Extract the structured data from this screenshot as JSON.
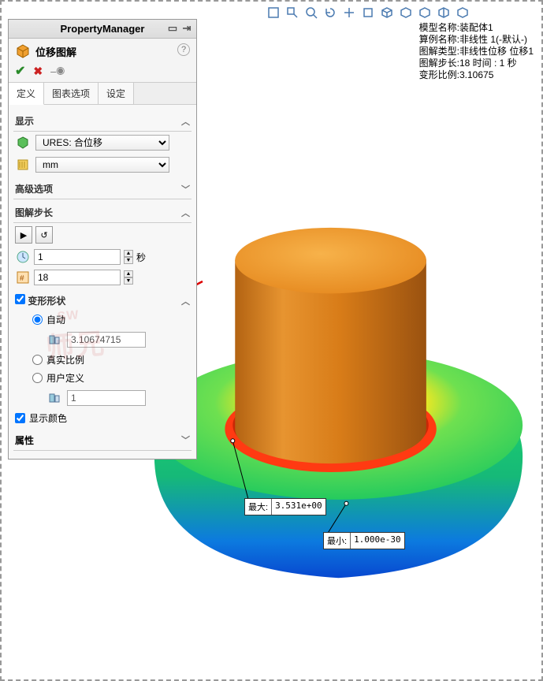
{
  "header": {
    "title": "PropertyManager"
  },
  "title_row": {
    "label": "位移图解"
  },
  "tabs": {
    "t0": "定义",
    "t1": "图表选项",
    "t2": "设定"
  },
  "sections": {
    "display": {
      "title": "显示",
      "component_select": "URES: 合位移",
      "unit_select": "mm"
    },
    "advanced": {
      "title": "高级选项"
    },
    "step": {
      "title": "图解步长",
      "time_value": "1",
      "time_unit": "秒",
      "step_value": "18"
    },
    "deform": {
      "title": "变形形状",
      "opt_auto": "自动",
      "auto_value": "3.10674715",
      "opt_true": "真实比例",
      "opt_user": "用户定义",
      "user_value": "1",
      "show_color": "显示颜色"
    },
    "props": {
      "title": "属性"
    }
  },
  "overlay": {
    "l1_k": "模型名称:",
    "l1_v": "装配体1",
    "l2_k": "算例名称:",
    "l2_v": "非线性 1(-默认-)",
    "l3_k": "图解类型:",
    "l3_v": "非线性位移 位移1",
    "l4_k": "图解步长:",
    "l4_v": "18   时间 :  1 秒",
    "l5_k": "变形比例:",
    "l5_v": "3.10675"
  },
  "callouts": {
    "max": {
      "name": "最大:",
      "value": "3.531e+00"
    },
    "min": {
      "name": "最小:",
      "value": "1.000e-30"
    }
  },
  "watermark": {
    "top": "SW",
    "main": "师兄"
  }
}
